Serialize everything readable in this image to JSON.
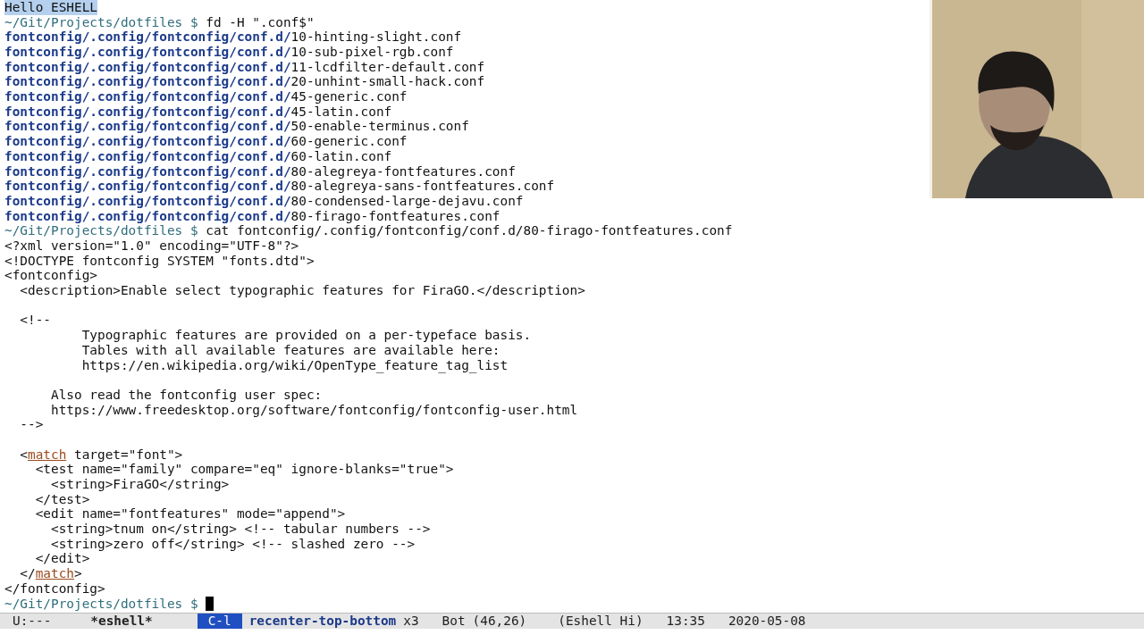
{
  "buffer": {
    "lines": [
      {
        "segments": [
          {
            "kind": "selected",
            "text": "Hello ESHELL"
          }
        ]
      },
      {
        "segments": [
          {
            "kind": "prompt",
            "text": "~/Git/Projects/dotfiles $"
          },
          {
            "kind": "plain",
            "text": "fd -H \".conf$\""
          }
        ]
      },
      {
        "segments": [
          {
            "kind": "dir",
            "text": "fontconfig/.config/fontconfig/conf.d/"
          },
          {
            "kind": "plain",
            "text": "10-hinting-slight.conf"
          }
        ]
      },
      {
        "segments": [
          {
            "kind": "dir",
            "text": "fontconfig/.config/fontconfig/conf.d/"
          },
          {
            "kind": "plain",
            "text": "10-sub-pixel-rgb.conf"
          }
        ]
      },
      {
        "segments": [
          {
            "kind": "dir",
            "text": "fontconfig/.config/fontconfig/conf.d/"
          },
          {
            "kind": "plain",
            "text": "11-lcdfilter-default.conf"
          }
        ]
      },
      {
        "segments": [
          {
            "kind": "dir",
            "text": "fontconfig/.config/fontconfig/conf.d/"
          },
          {
            "kind": "plain",
            "text": "20-unhint-small-hack.conf"
          }
        ]
      },
      {
        "segments": [
          {
            "kind": "dir",
            "text": "fontconfig/.config/fontconfig/conf.d/"
          },
          {
            "kind": "plain",
            "text": "45-generic.conf"
          }
        ]
      },
      {
        "segments": [
          {
            "kind": "dir",
            "text": "fontconfig/.config/fontconfig/conf.d/"
          },
          {
            "kind": "plain",
            "text": "45-latin.conf"
          }
        ]
      },
      {
        "segments": [
          {
            "kind": "dir",
            "text": "fontconfig/.config/fontconfig/conf.d/"
          },
          {
            "kind": "plain",
            "text": "50-enable-terminus.conf"
          }
        ]
      },
      {
        "segments": [
          {
            "kind": "dir",
            "text": "fontconfig/.config/fontconfig/conf.d/"
          },
          {
            "kind": "plain",
            "text": "60-generic.conf"
          }
        ]
      },
      {
        "segments": [
          {
            "kind": "dir",
            "text": "fontconfig/.config/fontconfig/conf.d/"
          },
          {
            "kind": "plain",
            "text": "60-latin.conf"
          }
        ]
      },
      {
        "segments": [
          {
            "kind": "dir",
            "text": "fontconfig/.config/fontconfig/conf.d/"
          },
          {
            "kind": "plain",
            "text": "80-alegreya-fontfeatures.conf"
          }
        ]
      },
      {
        "segments": [
          {
            "kind": "dir",
            "text": "fontconfig/.config/fontconfig/conf.d/"
          },
          {
            "kind": "plain",
            "text": "80-alegreya-sans-fontfeatures.conf"
          }
        ]
      },
      {
        "segments": [
          {
            "kind": "dir",
            "text": "fontconfig/.config/fontconfig/conf.d/"
          },
          {
            "kind": "plain",
            "text": "80-condensed-large-dejavu.conf"
          }
        ]
      },
      {
        "segments": [
          {
            "kind": "dir",
            "text": "fontconfig/.config/fontconfig/conf.d/"
          },
          {
            "kind": "plain",
            "text": "80-firago-fontfeatures.conf"
          }
        ]
      },
      {
        "segments": [
          {
            "kind": "prompt",
            "text": "~/Git/Projects/dotfiles $"
          },
          {
            "kind": "plain",
            "text": "cat fontconfig/.config/fontconfig/conf.d/80-firago-fontfeatures.conf"
          }
        ]
      },
      {
        "segments": [
          {
            "kind": "plain",
            "text": "<?xml version=\"1.0\" encoding=\"UTF-8\"?>"
          }
        ]
      },
      {
        "segments": [
          {
            "kind": "plain",
            "text": "<!DOCTYPE fontconfig SYSTEM \"fonts.dtd\">"
          }
        ]
      },
      {
        "segments": [
          {
            "kind": "plain",
            "text": "<fontconfig>"
          }
        ]
      },
      {
        "segments": [
          {
            "kind": "plain",
            "text": "  <description>Enable select typographic features for FiraGO.</description>"
          }
        ]
      },
      {
        "segments": [
          {
            "kind": "plain",
            "text": "  <!--"
          }
        ],
        "after_blank_line": true
      },
      {
        "segments": [
          {
            "kind": "plain",
            "text": "          Typographic features are provided on a per-typeface basis."
          }
        ]
      },
      {
        "segments": [
          {
            "kind": "plain",
            "text": "          Tables with all available features are available here:"
          }
        ]
      },
      {
        "segments": [
          {
            "kind": "plain",
            "text": "          https://en.wikipedia.org/wiki/OpenType_feature_tag_list"
          }
        ]
      },
      {
        "segments": [
          {
            "kind": "plain",
            "text": "      Also read the fontconfig user spec:"
          }
        ],
        "after_blank_line": true
      },
      {
        "segments": [
          {
            "kind": "plain",
            "text": "      https://www.freedesktop.org/software/fontconfig/fontconfig-user.html"
          }
        ]
      },
      {
        "segments": [
          {
            "kind": "plain",
            "text": "  -->"
          }
        ]
      },
      {
        "segments": [
          {
            "kind": "plain",
            "text": "  <"
          },
          {
            "kind": "tag",
            "text": "match"
          },
          {
            "kind": "plain",
            "text": " target=\"font\">"
          }
        ],
        "after_blank_line": true
      },
      {
        "segments": [
          {
            "kind": "plain",
            "text": "    <test name=\"family\" compare=\"eq\" ignore-blanks=\"true\">"
          }
        ]
      },
      {
        "segments": [
          {
            "kind": "plain",
            "text": "      <string>FiraGO</string>"
          }
        ]
      },
      {
        "segments": [
          {
            "kind": "plain",
            "text": "    </test>"
          }
        ]
      },
      {
        "segments": [
          {
            "kind": "plain",
            "text": "    <edit name=\"fontfeatures\" mode=\"append\">"
          }
        ]
      },
      {
        "segments": [
          {
            "kind": "plain",
            "text": "      <string>tnum on</string> <!-- tabular numbers -->"
          }
        ]
      },
      {
        "segments": [
          {
            "kind": "plain",
            "text": "      <string>zero off</string> <!-- slashed zero -->"
          }
        ]
      },
      {
        "segments": [
          {
            "kind": "plain",
            "text": "    </edit>"
          }
        ]
      },
      {
        "segments": [
          {
            "kind": "plain",
            "text": "  </"
          },
          {
            "kind": "tag",
            "text": "match"
          },
          {
            "kind": "plain",
            "text": ">"
          }
        ]
      },
      {
        "segments": [
          {
            "kind": "plain",
            "text": "</fontconfig>"
          }
        ]
      },
      {
        "segments": [
          {
            "kind": "prompt",
            "text": "~/Git/Projects/dotfiles $"
          }
        ],
        "cursor": true
      }
    ]
  },
  "mode_line": {
    "segments": [
      {
        "kind": "plain",
        "text": "U:---"
      },
      {
        "kind": "bold",
        "text": "*eshell*"
      },
      {
        "kind": "key",
        "text": "C-l"
      },
      {
        "kind": "command",
        "text": "recenter-top-bottom"
      },
      {
        "kind": "plain",
        "text": "x3"
      },
      {
        "kind": "plain",
        "text": "Bot"
      },
      {
        "kind": "plain",
        "text": "(46,26)"
      },
      {
        "kind": "plain",
        "text": "(Eshell Hi)"
      },
      {
        "kind": "plain",
        "text": "13:35"
      },
      {
        "kind": "plain",
        "text": "2020-05-08"
      }
    ]
  }
}
